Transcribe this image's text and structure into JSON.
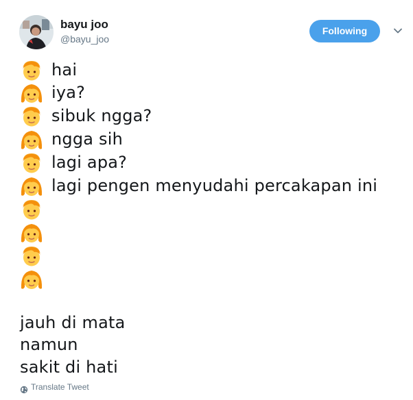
{
  "author": {
    "display_name": "bayu joo",
    "handle": "@bayu_joo",
    "avatar": "avatar-photo"
  },
  "actions": {
    "follow_label": "Following",
    "menu_icon": "chevron-down-icon"
  },
  "conversation": [
    {
      "speaker": "boy-emoji",
      "text": "hai"
    },
    {
      "speaker": "girl-emoji",
      "text": "iya?"
    },
    {
      "speaker": "boy-emoji",
      "text": "sibuk ngga?"
    },
    {
      "speaker": "girl-emoji",
      "text": "ngga sih"
    },
    {
      "speaker": "boy-emoji",
      "text": "lagi apa?"
    },
    {
      "speaker": "girl-emoji",
      "text": "lagi pengen menyudahi percakapan ini"
    },
    {
      "speaker": "boy-emoji",
      "text": ""
    },
    {
      "speaker": "girl-emoji",
      "text": ""
    },
    {
      "speaker": "boy-emoji",
      "text": ""
    },
    {
      "speaker": "girl-emoji",
      "text": ""
    }
  ],
  "verse": [
    "jauh di mata",
    "namun",
    "sakit di hati"
  ],
  "footer": {
    "translate_label": "Translate Tweet",
    "icon": "globe-icon"
  },
  "colors": {
    "follow_button": "#4aa1eb",
    "text": "#14171a",
    "muted": "#657786"
  }
}
